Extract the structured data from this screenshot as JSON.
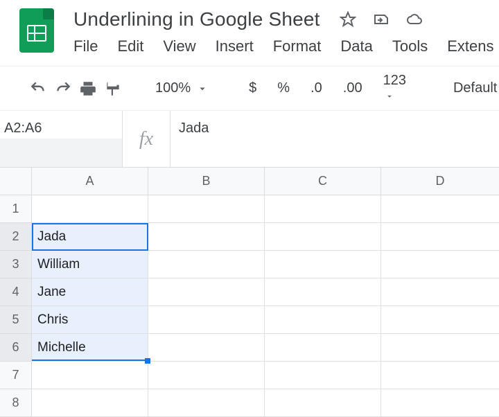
{
  "doc": {
    "title": "Underlining in Google Sheet"
  },
  "menus": {
    "file": "File",
    "edit": "Edit",
    "view": "View",
    "insert": "Insert",
    "format": "Format",
    "data": "Data",
    "tools": "Tools",
    "extensions": "Extens"
  },
  "toolbar": {
    "zoom": "100%",
    "currency": "$",
    "percent": "%",
    "dec_dec": ".0",
    "inc_dec": ".00",
    "numfmt": "123",
    "font": "Default"
  },
  "namebox": "A2:A6",
  "fx": "fx",
  "formula": "Jada",
  "columns": {
    "A": "A",
    "B": "B",
    "C": "C",
    "D": "D"
  },
  "rows": {
    "r1": "1",
    "r2": "2",
    "r3": "3",
    "r4": "4",
    "r5": "5",
    "r6": "6",
    "r7": "7",
    "r8": "8"
  },
  "cells": {
    "A2": "Jada",
    "A3": "William",
    "A4": "Jane",
    "A5": "Chris",
    "A6": "Michelle"
  }
}
